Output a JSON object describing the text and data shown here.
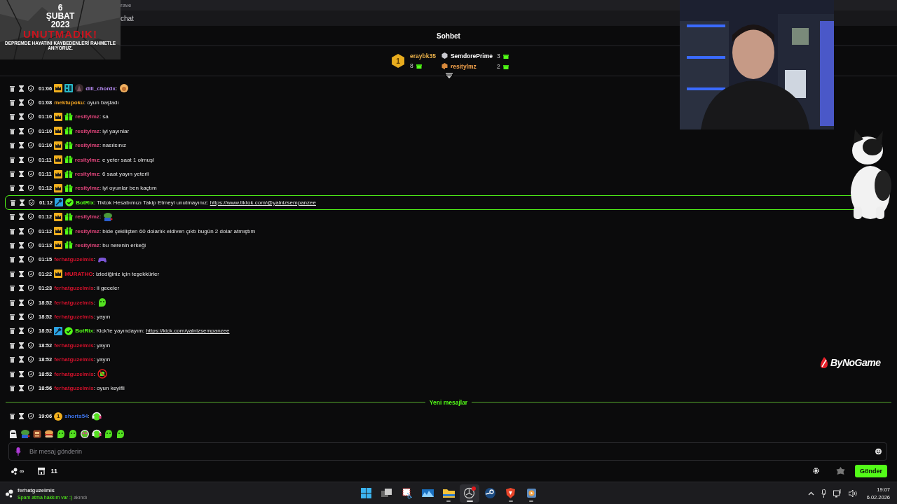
{
  "browser_tabs": [
    "rave",
    "chat"
  ],
  "overlay_banner": {
    "lines": [
      {
        "kind": "title",
        "text": "6"
      },
      {
        "kind": "title",
        "text": "ŞUBAT"
      },
      {
        "kind": "title",
        "text": "2023"
      },
      {
        "kind": "alert",
        "text": "UNUTMADIK!"
      }
    ],
    "caption": "DEPREMDE HAYATINI KAYBEDENLERİ RAHMETLE ANIYORUZ."
  },
  "chat_title": "Sohbet",
  "top_gifter": {
    "rank": "1",
    "name": "eraybk35",
    "count": "8"
  },
  "gifters": [
    {
      "kind": "silver",
      "name": "SemdorePrime",
      "count": "3",
      "color": "#ffffff"
    },
    {
      "kind": "bronze",
      "name": "resitylmz",
      "count": "2",
      "color": "#f2a14b"
    }
  ],
  "messages": [
    {
      "time": "01:06",
      "badges": [
        {
          "kind": "crown"
        },
        {
          "kind": "tiles"
        },
        {
          "kind": "avatar"
        }
      ],
      "user": "dill_chordx",
      "color": "#b88cf5",
      "text": ":",
      "emote": {
        "kind": "hug"
      },
      "highlighted": false
    },
    {
      "time": "01:08",
      "user": "mektupoku",
      "color": "#f5a623",
      "text": ": oyun başladı",
      "highlighted": false
    },
    {
      "time": "01:10",
      "badges": [
        {
          "kind": "crown"
        },
        {
          "kind": "gift"
        }
      ],
      "user": "resitylmz",
      "color": "#e0457b",
      "text": ": sa",
      "highlighted": false
    },
    {
      "time": "01:10",
      "badges": [
        {
          "kind": "crown"
        },
        {
          "kind": "gift"
        }
      ],
      "user": "resitylmz",
      "color": "#e0457b",
      "text": ": iyi yayınlar",
      "highlighted": false
    },
    {
      "time": "01:10",
      "badges": [
        {
          "kind": "crown"
        },
        {
          "kind": "gift"
        }
      ],
      "user": "resitylmz",
      "color": "#e0457b",
      "text": ": nasılsınız",
      "highlighted": false
    },
    {
      "time": "01:11",
      "badges": [
        {
          "kind": "crown"
        },
        {
          "kind": "gift"
        }
      ],
      "user": "resitylmz",
      "color": "#e0457b",
      "text": ": e yeter saat 1 olmuşl",
      "highlighted": false
    },
    {
      "time": "01:11",
      "badges": [
        {
          "kind": "crown"
        },
        {
          "kind": "gift"
        }
      ],
      "user": "resitylmz",
      "color": "#e0457b",
      "text": ": 6 saat yayın yeterli",
      "highlighted": false
    },
    {
      "time": "01:12",
      "badges": [
        {
          "kind": "crown"
        },
        {
          "kind": "gift"
        }
      ],
      "user": "resitylmz",
      "color": "#e0457b",
      "text": ": iyi oyunlar ben kaçtım",
      "highlighted": false
    },
    {
      "time": "01:12",
      "badges": [
        {
          "kind": "mod"
        },
        {
          "kind": "verified"
        }
      ],
      "user": "BotRix",
      "color": "#53fc18",
      "text": ": Tiktok Hesabımızı Takip Etmeyi unutmayınız:",
      "link": "https://www.tiktok.com/@yalnizsempanzee",
      "highlighted": true
    },
    {
      "time": "01:12",
      "badges": [
        {
          "kind": "crown"
        },
        {
          "kind": "gift"
        }
      ],
      "user": "resitylmz",
      "color": "#e0457b",
      "text": ":",
      "emote": {
        "kind": "frog"
      },
      "highlighted": false
    },
    {
      "time": "01:12",
      "badges": [
        {
          "kind": "crown"
        },
        {
          "kind": "gift"
        }
      ],
      "user": "resitylmz",
      "color": "#e0457b",
      "text": ": bide çekilişten 60 dolarlık eldiven çıktı bugün 2 dolar atmıştım",
      "highlighted": false
    },
    {
      "time": "01:13",
      "badges": [
        {
          "kind": "crown"
        },
        {
          "kind": "gift"
        }
      ],
      "user": "resitylmz",
      "color": "#e0457b",
      "text": ": bu nerenin erkeği",
      "highlighted": false
    },
    {
      "time": "01:15",
      "user": "ferhatguzelmis",
      "color": "#d0112b",
      "text": ":",
      "emote": {
        "kind": "controller"
      },
      "highlighted": false
    },
    {
      "time": "01:22",
      "badges": [
        {
          "kind": "crown"
        }
      ],
      "user": "MURATHO",
      "color": "#e8132e",
      "text": ": izlediğiniz için teşekkürler",
      "highlighted": false
    },
    {
      "time": "01:23",
      "user": "ferhatguzelmis",
      "color": "#d0112b",
      "text": ": ii geceler",
      "highlighted": false
    },
    {
      "time": "18:52",
      "user": "ferhatguzelmis",
      "color": "#d0112b",
      "text": ":",
      "emote": {
        "kind": "blob"
      },
      "highlighted": false
    },
    {
      "time": "18:52",
      "user": "ferhatguzelmis",
      "color": "#d0112b",
      "text": ": yayın",
      "highlighted": false
    },
    {
      "time": "18:52",
      "badges": [
        {
          "kind": "mod"
        },
        {
          "kind": "verified"
        }
      ],
      "user": "BotRix",
      "color": "#53fc18",
      "text": ": Kick'te yayındayım:",
      "link": "https://kick.com/yalnizsempanzee",
      "highlighted": false
    },
    {
      "time": "18:52",
      "user": "ferhatguzelmis",
      "color": "#d0112b",
      "text": ": yayın",
      "highlighted": false
    },
    {
      "time": "18:52",
      "user": "ferhatguzelmis",
      "color": "#d0112b",
      "text": ": yayın",
      "highlighted": false
    },
    {
      "time": "18:52",
      "user": "ferhatguzelmis",
      "color": "#d0112b",
      "text": ":",
      "emote": {
        "kind": "ban"
      },
      "highlighted": false
    },
    {
      "time": "18:56",
      "user": "ferhatguzelmis",
      "color": "#d0112b",
      "text": ": oyun keyifli",
      "highlighted": false
    }
  ],
  "new_messages_label": "Yeni mesajlar",
  "new_messages": [
    {
      "time": "19:06",
      "badges": [
        {
          "kind": "coin",
          "label": "1"
        }
      ],
      "user": "shorts54",
      "color": "#3b72e8",
      "text": ":",
      "emote": {
        "kind": "headphones"
      },
      "highlighted": false
    }
  ],
  "emote_bar": [
    {
      "kind": "ghost"
    },
    {
      "kind": "frog"
    },
    {
      "kind": "crate"
    },
    {
      "kind": "burger"
    },
    {
      "kind": "blob"
    },
    {
      "kind": "blob"
    },
    {
      "kind": "robot"
    },
    {
      "kind": "headphones"
    },
    {
      "kind": "blob"
    },
    {
      "kind": "blob"
    }
  ],
  "composer": {
    "placeholder": "Bir mesaj gönderin",
    "points": "∞",
    "store_count": "11",
    "send": "Gönder"
  },
  "stream_logo": "ByNoGame",
  "taskbar": {
    "user": "ferhatguzelmis",
    "status": "Spam atma hakkım var :)",
    "status_note": "akındı",
    "apps": [
      {
        "kind": "start",
        "running": false,
        "selected": false,
        "notification": false
      },
      {
        "kind": "taskview",
        "running": false,
        "selected": false,
        "notification": false
      },
      {
        "kind": "snip",
        "running": false,
        "selected": false,
        "notification": false
      },
      {
        "kind": "photos",
        "running": false,
        "selected": false,
        "notification": false
      },
      {
        "kind": "folder",
        "running": true,
        "selected": false,
        "notification": false
      },
      {
        "kind": "aperture",
        "running": true,
        "selected": true,
        "notification": true
      },
      {
        "kind": "launcher",
        "running": false,
        "selected": false,
        "notification": false
      },
      {
        "kind": "browser",
        "running": true,
        "selected": false,
        "notification": false
      },
      {
        "kind": "player",
        "running": true,
        "selected": false,
        "notification": false
      }
    ],
    "time": "19:07",
    "date": "6.02.2026"
  }
}
